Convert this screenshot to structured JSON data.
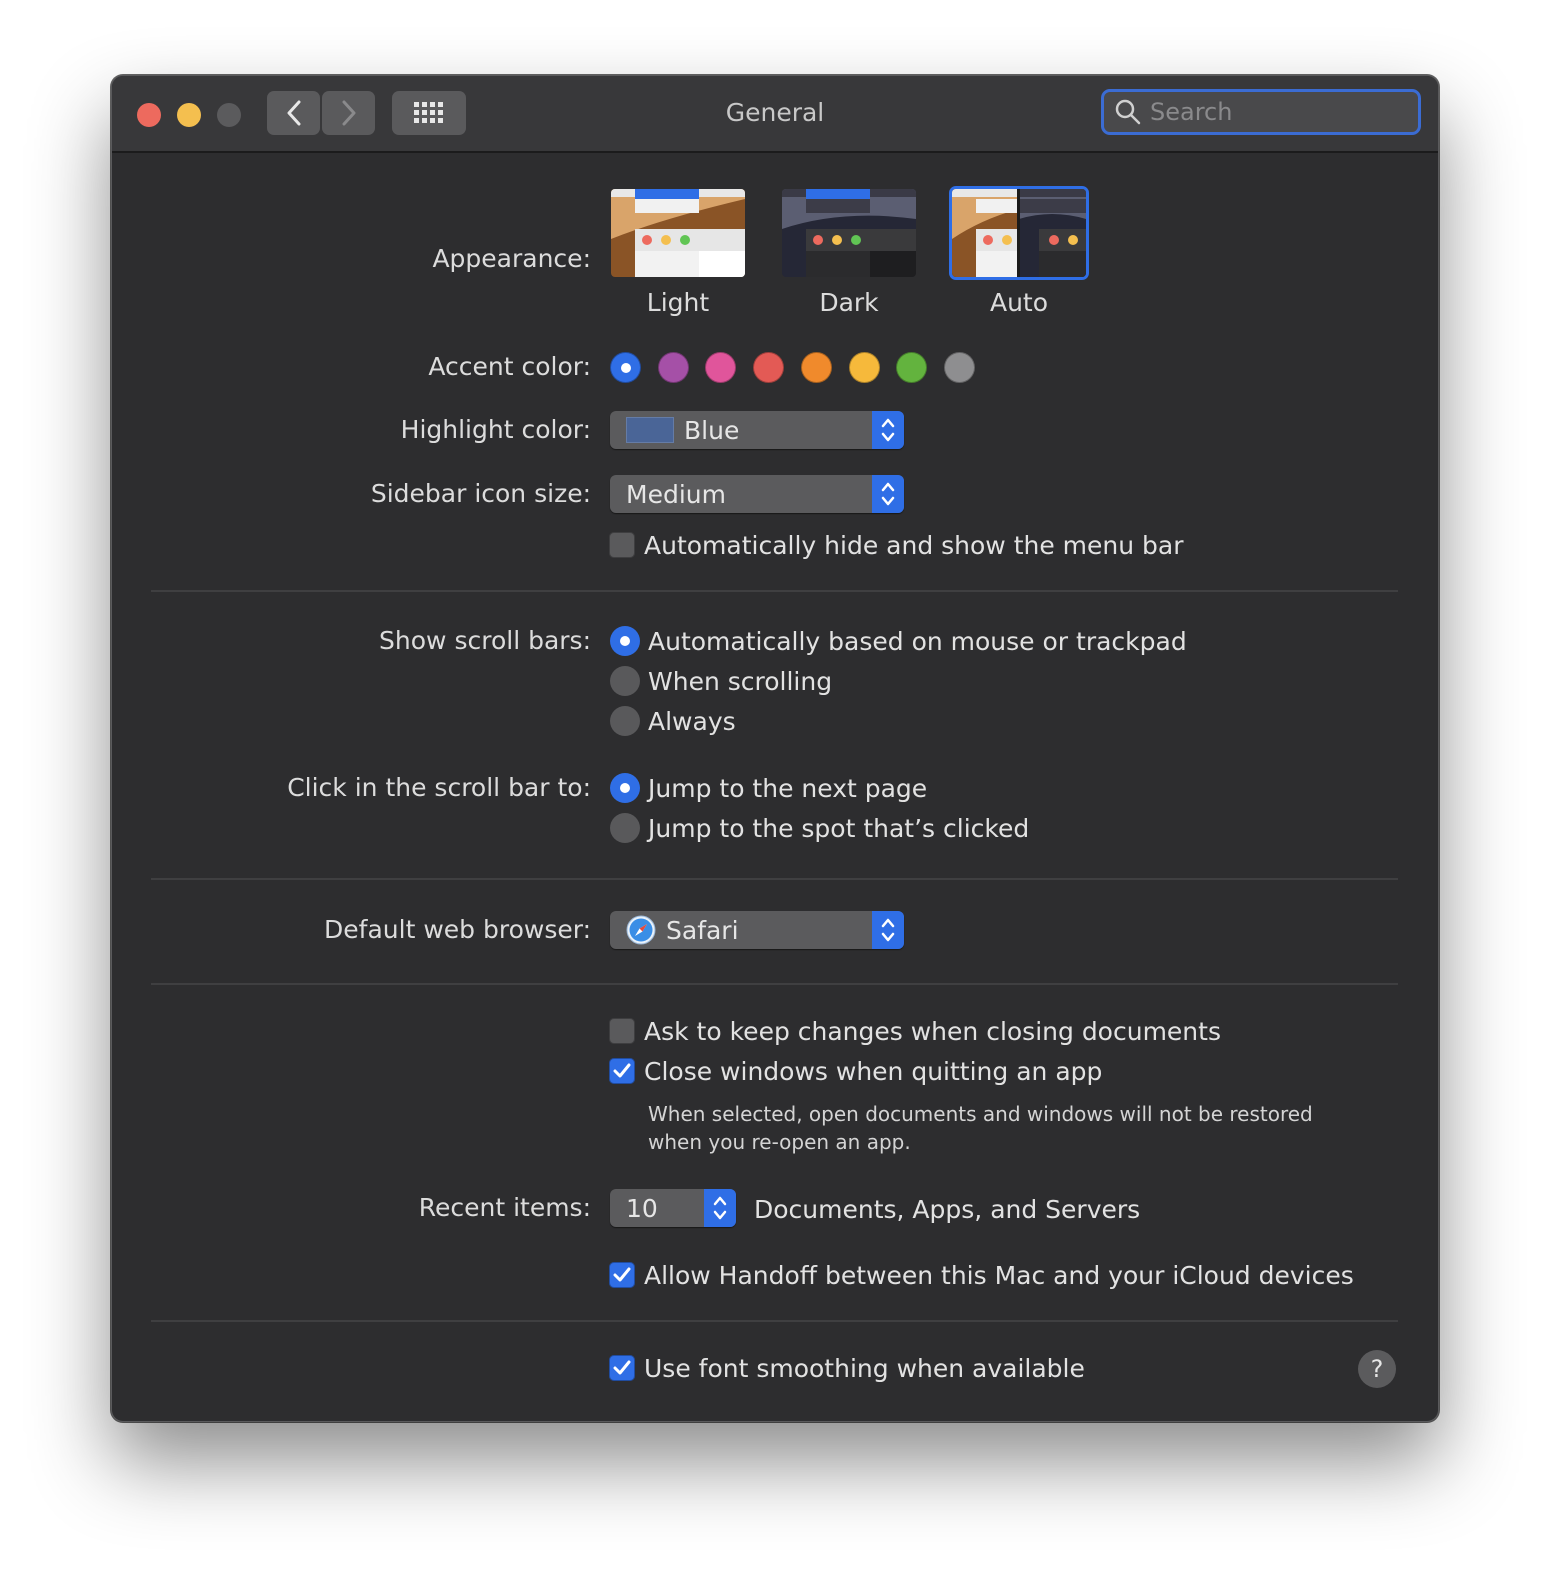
{
  "window": {
    "title": "General",
    "search_placeholder": "Search"
  },
  "appearance": {
    "label": "Appearance:",
    "options": [
      {
        "name": "Light",
        "selected": false
      },
      {
        "name": "Dark",
        "selected": false
      },
      {
        "name": "Auto",
        "selected": true
      }
    ]
  },
  "accent": {
    "label": "Accent color:",
    "colors": [
      "#2f6ee6",
      "#a550a7",
      "#e0559b",
      "#e35a55",
      "#f08a2c",
      "#f6b93b",
      "#63b33e",
      "#8e8e90"
    ],
    "selected_index": 0
  },
  "highlight": {
    "label": "Highlight color:",
    "value": "Blue",
    "swatch_color": "#4a6597"
  },
  "sidebar_icon": {
    "label": "Sidebar icon size:",
    "value": "Medium"
  },
  "menubar": {
    "label": "Automatically hide and show the menu bar",
    "checked": false
  },
  "scroll_bars": {
    "label": "Show scroll bars:",
    "options": [
      "Automatically based on mouse or trackpad",
      "When scrolling",
      "Always"
    ],
    "selected_index": 0
  },
  "click_scroll": {
    "label": "Click in the scroll bar to:",
    "options": [
      "Jump to the next page",
      "Jump to the spot that’s clicked"
    ],
    "selected_index": 0
  },
  "browser": {
    "label": "Default web browser:",
    "value": "Safari"
  },
  "documents": {
    "ask_keep": {
      "label": "Ask to keep changes when closing documents",
      "checked": false
    },
    "close_windows": {
      "label": "Close windows when quitting an app",
      "checked": true
    },
    "note": "When selected, open documents and windows will not be restored when you re-open an app."
  },
  "recent": {
    "label": "Recent items:",
    "value": "10",
    "suffix": "Documents, Apps, and Servers"
  },
  "handoff": {
    "label": "Allow Handoff between this Mac and your iCloud devices",
    "checked": true
  },
  "font_smoothing": {
    "label": "Use font smoothing when available",
    "checked": true
  },
  "help": {
    "glyph": "?"
  }
}
